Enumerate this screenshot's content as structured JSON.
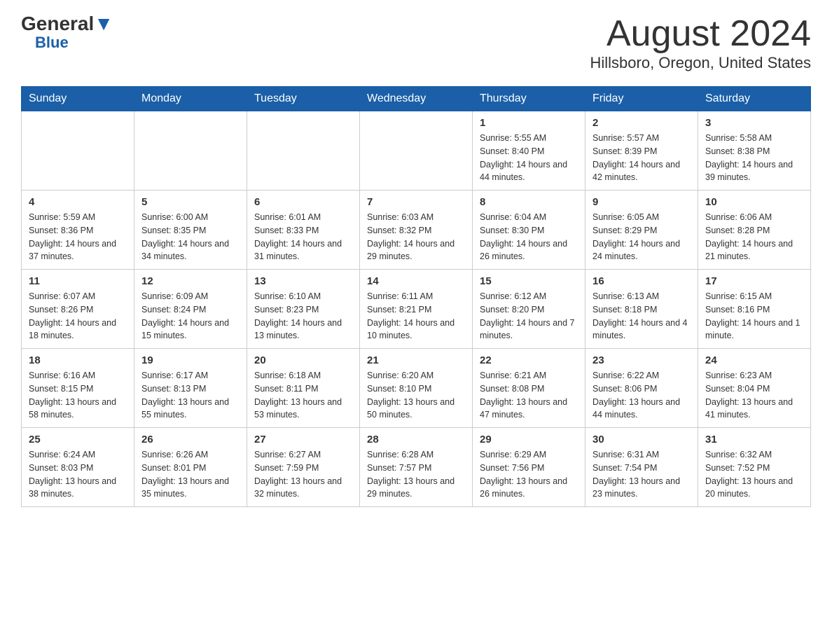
{
  "header": {
    "logo_general": "General",
    "logo_blue": "Blue",
    "month_title": "August 2024",
    "location": "Hillsboro, Oregon, United States"
  },
  "days_of_week": [
    "Sunday",
    "Monday",
    "Tuesday",
    "Wednesday",
    "Thursday",
    "Friday",
    "Saturday"
  ],
  "weeks": [
    [
      {
        "day": "",
        "info": ""
      },
      {
        "day": "",
        "info": ""
      },
      {
        "day": "",
        "info": ""
      },
      {
        "day": "",
        "info": ""
      },
      {
        "day": "1",
        "info": "Sunrise: 5:55 AM\nSunset: 8:40 PM\nDaylight: 14 hours and 44 minutes."
      },
      {
        "day": "2",
        "info": "Sunrise: 5:57 AM\nSunset: 8:39 PM\nDaylight: 14 hours and 42 minutes."
      },
      {
        "day": "3",
        "info": "Sunrise: 5:58 AM\nSunset: 8:38 PM\nDaylight: 14 hours and 39 minutes."
      }
    ],
    [
      {
        "day": "4",
        "info": "Sunrise: 5:59 AM\nSunset: 8:36 PM\nDaylight: 14 hours and 37 minutes."
      },
      {
        "day": "5",
        "info": "Sunrise: 6:00 AM\nSunset: 8:35 PM\nDaylight: 14 hours and 34 minutes."
      },
      {
        "day": "6",
        "info": "Sunrise: 6:01 AM\nSunset: 8:33 PM\nDaylight: 14 hours and 31 minutes."
      },
      {
        "day": "7",
        "info": "Sunrise: 6:03 AM\nSunset: 8:32 PM\nDaylight: 14 hours and 29 minutes."
      },
      {
        "day": "8",
        "info": "Sunrise: 6:04 AM\nSunset: 8:30 PM\nDaylight: 14 hours and 26 minutes."
      },
      {
        "day": "9",
        "info": "Sunrise: 6:05 AM\nSunset: 8:29 PM\nDaylight: 14 hours and 24 minutes."
      },
      {
        "day": "10",
        "info": "Sunrise: 6:06 AM\nSunset: 8:28 PM\nDaylight: 14 hours and 21 minutes."
      }
    ],
    [
      {
        "day": "11",
        "info": "Sunrise: 6:07 AM\nSunset: 8:26 PM\nDaylight: 14 hours and 18 minutes."
      },
      {
        "day": "12",
        "info": "Sunrise: 6:09 AM\nSunset: 8:24 PM\nDaylight: 14 hours and 15 minutes."
      },
      {
        "day": "13",
        "info": "Sunrise: 6:10 AM\nSunset: 8:23 PM\nDaylight: 14 hours and 13 minutes."
      },
      {
        "day": "14",
        "info": "Sunrise: 6:11 AM\nSunset: 8:21 PM\nDaylight: 14 hours and 10 minutes."
      },
      {
        "day": "15",
        "info": "Sunrise: 6:12 AM\nSunset: 8:20 PM\nDaylight: 14 hours and 7 minutes."
      },
      {
        "day": "16",
        "info": "Sunrise: 6:13 AM\nSunset: 8:18 PM\nDaylight: 14 hours and 4 minutes."
      },
      {
        "day": "17",
        "info": "Sunrise: 6:15 AM\nSunset: 8:16 PM\nDaylight: 14 hours and 1 minute."
      }
    ],
    [
      {
        "day": "18",
        "info": "Sunrise: 6:16 AM\nSunset: 8:15 PM\nDaylight: 13 hours and 58 minutes."
      },
      {
        "day": "19",
        "info": "Sunrise: 6:17 AM\nSunset: 8:13 PM\nDaylight: 13 hours and 55 minutes."
      },
      {
        "day": "20",
        "info": "Sunrise: 6:18 AM\nSunset: 8:11 PM\nDaylight: 13 hours and 53 minutes."
      },
      {
        "day": "21",
        "info": "Sunrise: 6:20 AM\nSunset: 8:10 PM\nDaylight: 13 hours and 50 minutes."
      },
      {
        "day": "22",
        "info": "Sunrise: 6:21 AM\nSunset: 8:08 PM\nDaylight: 13 hours and 47 minutes."
      },
      {
        "day": "23",
        "info": "Sunrise: 6:22 AM\nSunset: 8:06 PM\nDaylight: 13 hours and 44 minutes."
      },
      {
        "day": "24",
        "info": "Sunrise: 6:23 AM\nSunset: 8:04 PM\nDaylight: 13 hours and 41 minutes."
      }
    ],
    [
      {
        "day": "25",
        "info": "Sunrise: 6:24 AM\nSunset: 8:03 PM\nDaylight: 13 hours and 38 minutes."
      },
      {
        "day": "26",
        "info": "Sunrise: 6:26 AM\nSunset: 8:01 PM\nDaylight: 13 hours and 35 minutes."
      },
      {
        "day": "27",
        "info": "Sunrise: 6:27 AM\nSunset: 7:59 PM\nDaylight: 13 hours and 32 minutes."
      },
      {
        "day": "28",
        "info": "Sunrise: 6:28 AM\nSunset: 7:57 PM\nDaylight: 13 hours and 29 minutes."
      },
      {
        "day": "29",
        "info": "Sunrise: 6:29 AM\nSunset: 7:56 PM\nDaylight: 13 hours and 26 minutes."
      },
      {
        "day": "30",
        "info": "Sunrise: 6:31 AM\nSunset: 7:54 PM\nDaylight: 13 hours and 23 minutes."
      },
      {
        "day": "31",
        "info": "Sunrise: 6:32 AM\nSunset: 7:52 PM\nDaylight: 13 hours and 20 minutes."
      }
    ]
  ]
}
